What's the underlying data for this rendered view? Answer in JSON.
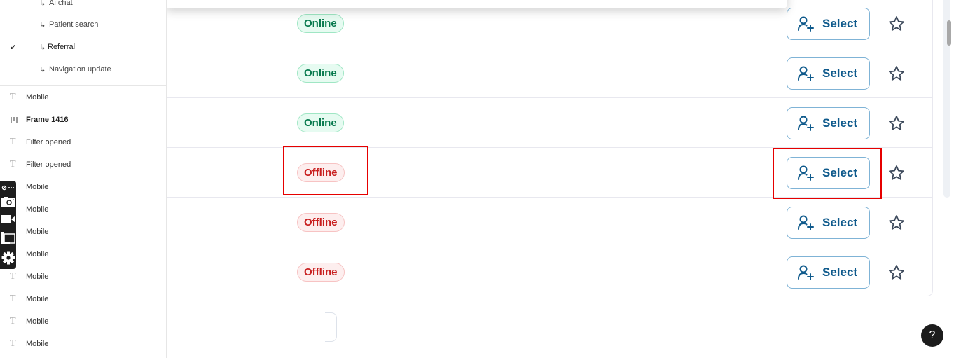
{
  "layers": {
    "sub_items": [
      {
        "label": "Ai chat",
        "checked": false
      },
      {
        "label": "Patient search",
        "checked": false
      },
      {
        "label": "Referral",
        "checked": true
      },
      {
        "label": "Navigation update",
        "checked": false
      }
    ],
    "sub_arrow": "↳",
    "check_glyph": "✔",
    "items": [
      {
        "label": "Mobile",
        "icon": "text-icon",
        "bold": false
      },
      {
        "label": "Frame 1416",
        "icon": "frame-icon",
        "bold": true
      },
      {
        "label": "Filter opened",
        "icon": "text-icon",
        "bold": false
      },
      {
        "label": "Filter opened",
        "icon": "text-icon",
        "bold": false
      },
      {
        "label": "Mobile",
        "icon": "text-icon",
        "bold": false
      },
      {
        "label": "Mobile",
        "icon": "text-icon",
        "bold": false
      },
      {
        "label": "Mobile",
        "icon": "text-icon",
        "bold": false
      },
      {
        "label": "Mobile",
        "icon": "text-icon",
        "bold": false
      },
      {
        "label": "Mobile",
        "icon": "text-icon",
        "bold": false
      },
      {
        "label": "Mobile",
        "icon": "text-icon",
        "bold": false
      },
      {
        "label": "Mobile",
        "icon": "text-icon",
        "bold": false
      },
      {
        "label": "Mobile",
        "icon": "text-icon",
        "bold": false
      }
    ],
    "text_icon_glyph": "T"
  },
  "toolstrip": {
    "tools": [
      "link-more-icon",
      "camera-icon",
      "video-icon",
      "window-icon",
      "gear-icon"
    ],
    "more_glyph": "⋯"
  },
  "table": {
    "rows": [
      {
        "status": "Online",
        "status_type": "online",
        "action_label": "Select"
      },
      {
        "status": "Online",
        "status_type": "online",
        "action_label": "Select"
      },
      {
        "status": "Online",
        "status_type": "online",
        "action_label": "Select"
      },
      {
        "status": "Offline",
        "status_type": "offline",
        "action_label": "Select"
      },
      {
        "status": "Offline",
        "status_type": "offline",
        "action_label": "Select"
      },
      {
        "status": "Offline",
        "status_type": "offline",
        "action_label": "Select"
      }
    ]
  },
  "colors": {
    "online_text": "#087a4e",
    "online_bg": "#e6fbf1",
    "offline_text": "#c81e1e",
    "offline_bg": "#fdeeee",
    "select_text": "#0f5a8c",
    "highlight": "#e60000"
  },
  "help": {
    "label": "?"
  }
}
